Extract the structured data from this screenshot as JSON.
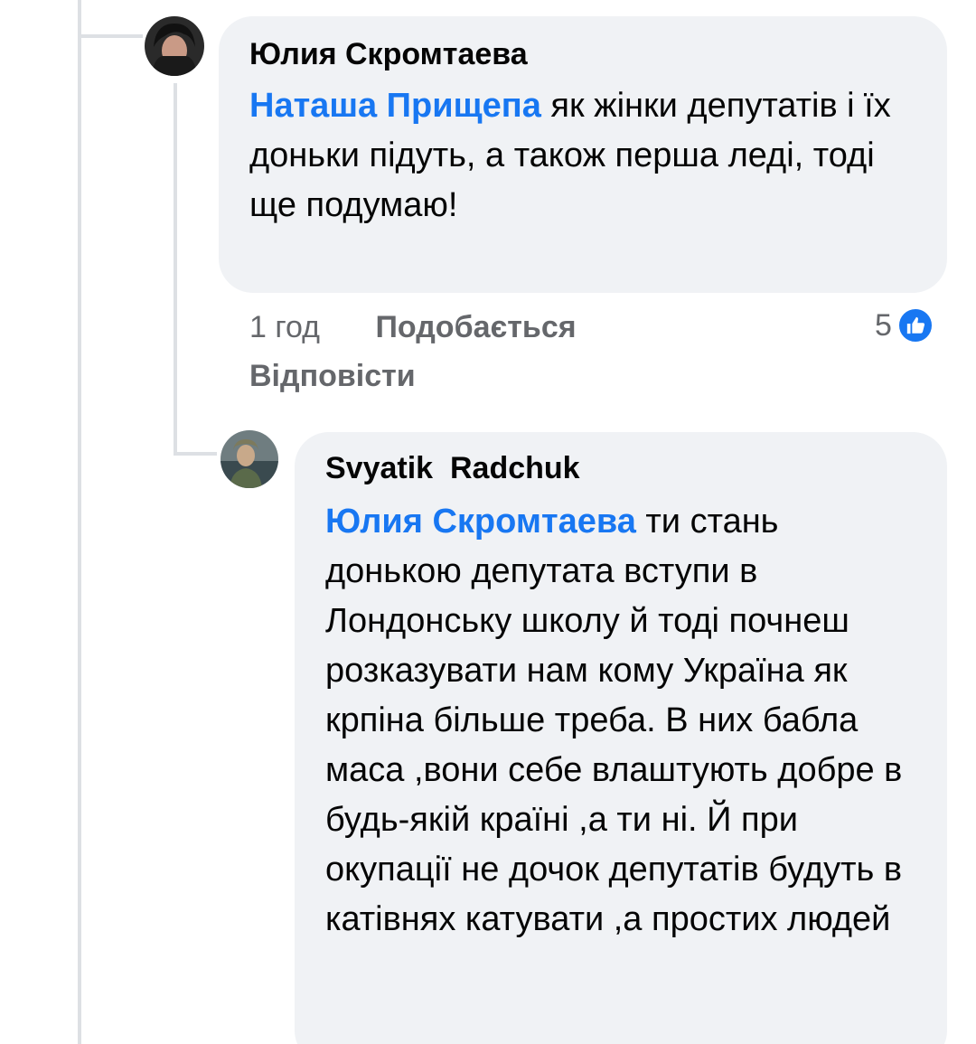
{
  "comment1": {
    "author": "Юлия Скромтаева",
    "mention": "Наташа Прищепа",
    "text": " як жінки депутатів і їх доньки підуть, а також перша леді, тоді ще подумаю!",
    "time": "1 год",
    "like_label": "Подобається",
    "reply_label": "Відповісти",
    "reaction_count": "5",
    "reaction_icon": "like-icon",
    "reaction_color": "#1877f2"
  },
  "comment2": {
    "author": "Svyatik  Radchuk",
    "mention": "Юлия Скромтаева",
    "text": " ти стань донькою депутата вступи в Лондонську школу й тоді почнеш розказувати нам кому Україна як крпіна більше треба. В них бабла маса ,вони себе влаштують добре в будь-якій країні ,а ти ні. Й при окупації не дочок депутатів будуть в катівнях катувати ,а простих людей"
  },
  "colors": {
    "mention": "#1877f2",
    "bubble": "#f0f2f5",
    "meta_text": "#65676b",
    "thread_line": "#dde0e4"
  }
}
